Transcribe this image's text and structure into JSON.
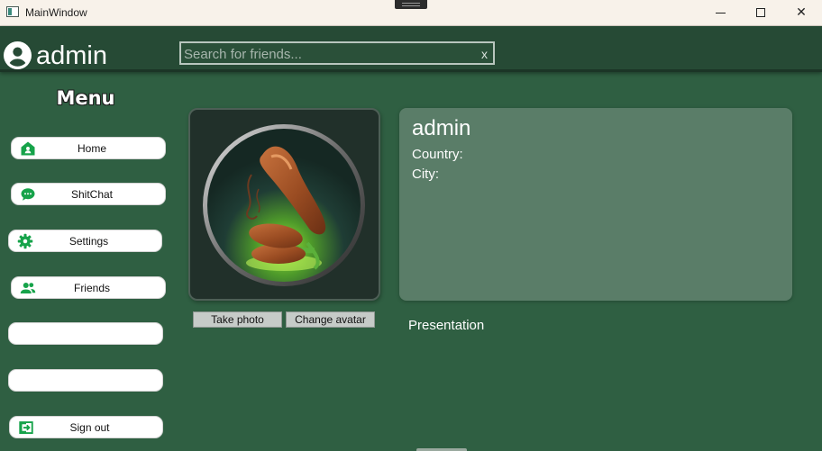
{
  "window": {
    "title": "MainWindow",
    "minimize_icon": "minimize-icon",
    "maximize_icon": "maximize-icon",
    "close_glyph": "✕"
  },
  "header": {
    "user_name": "admin",
    "user_icon": "account-circle-icon",
    "search": {
      "placeholder": "Search for friends...",
      "value": "",
      "clear_label": "x"
    }
  },
  "sidebar": {
    "title": "Menu",
    "items": [
      {
        "label": "Home",
        "icon": "home-icon"
      },
      {
        "label": "ShitChat",
        "icon": "chat-icon"
      },
      {
        "label": "Settings",
        "icon": "gear-icon"
      },
      {
        "label": "Friends",
        "icon": "friends-icon"
      },
      {
        "label": "",
        "icon": ""
      },
      {
        "label": "",
        "icon": ""
      },
      {
        "label": "Sign out",
        "icon": "sign-out-icon"
      }
    ]
  },
  "avatar": {
    "take_photo_label": "Take photo",
    "change_avatar_label": "Change avatar"
  },
  "profile": {
    "name": "admin",
    "country_label": "Country:",
    "country_value": "",
    "city_label": "City:",
    "city_value": "",
    "presentation_label": "Presentation"
  },
  "colors": {
    "background": "#2f5f42",
    "header": "#264a35",
    "card": "#5a7d68",
    "icon_green": "#16a34a"
  }
}
